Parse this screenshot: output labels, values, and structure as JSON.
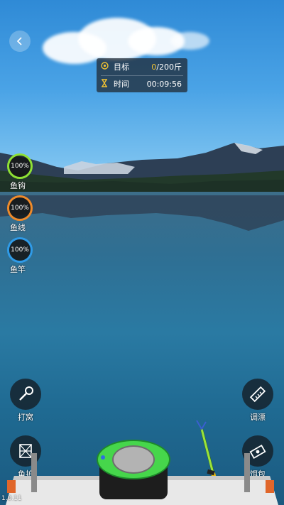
{
  "hud": {
    "target_label": "目标",
    "target_value_current": "0",
    "target_value_rest": "/200斤",
    "time_label": "时间",
    "time_value": "00:09:56"
  },
  "gauges": [
    {
      "label": "鱼钩",
      "value": "100%",
      "color": "#8ee034"
    },
    {
      "label": "鱼线",
      "value": "100%",
      "color": "#ef8a2a"
    },
    {
      "label": "鱼竿",
      "value": "100%",
      "color": "#2f9be8"
    }
  ],
  "actions": {
    "chum_label": "打窝",
    "float_label": "调漂",
    "net_label": "鱼护",
    "bait_label": "饵包"
  },
  "version": "1.0.11",
  "icons": {
    "back": "chevron-left-icon",
    "target": "target-icon",
    "time": "hourglass-icon"
  }
}
